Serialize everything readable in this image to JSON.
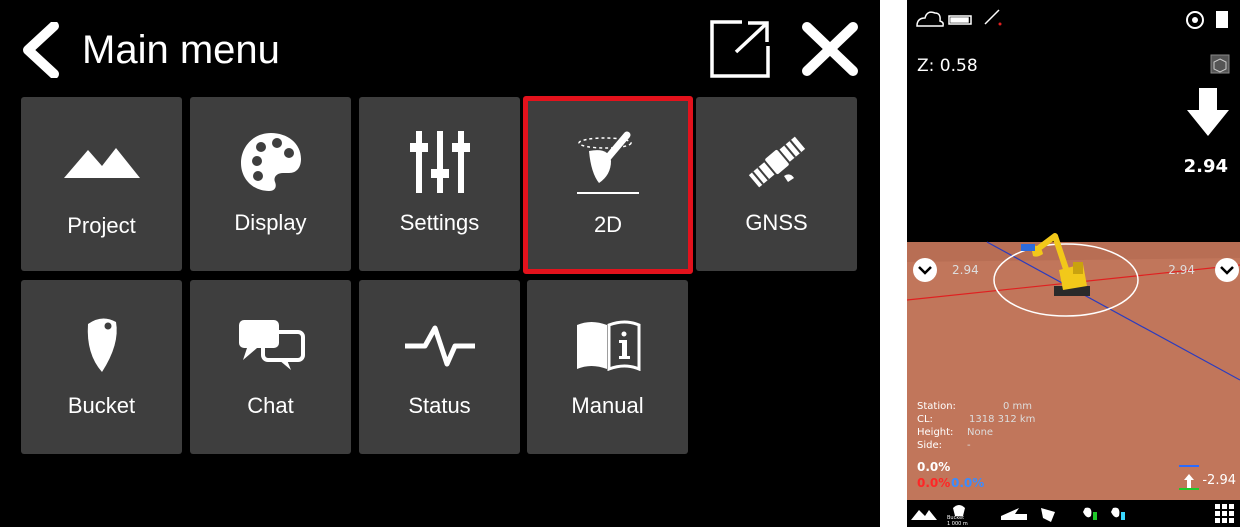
{
  "menu": {
    "title": "Main menu",
    "tiles": [
      {
        "label": "Project",
        "icon": "mountains-icon"
      },
      {
        "label": "Display",
        "icon": "palette-icon"
      },
      {
        "label": "Settings",
        "icon": "sliders-icon"
      },
      {
        "label": "2D",
        "icon": "bucket-2d-icon",
        "selected": true
      },
      {
        "label": "GNSS",
        "icon": "satellite-icon"
      },
      {
        "label": "Bucket",
        "icon": "bucket-icon"
      },
      {
        "label": "Chat",
        "icon": "chat-bubbles-icon"
      },
      {
        "label": "Status",
        "icon": "pulse-icon"
      },
      {
        "label": "Manual",
        "icon": "manual-book-icon"
      }
    ],
    "selection_color": "#e3121c"
  },
  "view": {
    "z_readout": "Z: 0.58",
    "depth_value": "2.94",
    "left_offset": "2.94",
    "right_offset": "2.94",
    "info": {
      "station_label": "Station:",
      "station_value": "0 mm",
      "cl_label": "CL:",
      "cl_value": "1318 312 km",
      "height_label": "Height:",
      "height_value": "None",
      "side_label": "Side:",
      "side_value": "-"
    },
    "slope_main": "0.0%",
    "slope_red": "0.0%",
    "slope_blue": "0.0%",
    "target_value": "-2.94",
    "bucket_tool_label": "Bucket",
    "bucket_tool_sub": "1 000 m",
    "colors": {
      "ground": "#c0755a",
      "grid_red": "#e02020",
      "grid_blue": "#2040c0",
      "machine": "#f2c81a"
    }
  }
}
